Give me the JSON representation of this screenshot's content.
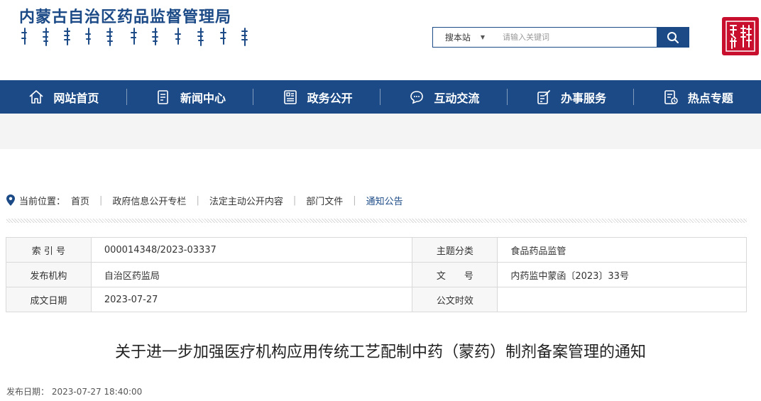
{
  "header": {
    "site_title": "内蒙古自治区药品监督管理局",
    "search": {
      "scope": "搜本站",
      "placeholder": "请输入关键词"
    }
  },
  "nav": {
    "items": [
      {
        "label": "网站首页",
        "icon": "home-icon"
      },
      {
        "label": "新闻中心",
        "icon": "news-icon"
      },
      {
        "label": "政务公开",
        "icon": "document-icon"
      },
      {
        "label": "互动交流",
        "icon": "chat-icon"
      },
      {
        "label": "办事服务",
        "icon": "service-icon"
      },
      {
        "label": "热点专题",
        "icon": "topic-icon"
      }
    ]
  },
  "breadcrumb": {
    "prefix": "当前位置：",
    "items": [
      "首页",
      "政府信息公开专栏",
      "法定主动公开内容",
      "部门文件",
      "通知公告"
    ]
  },
  "info": {
    "index_label": "索 引 号",
    "index_value": "000014348/2023-03337",
    "topic_label": "主题分类",
    "topic_value": "食品药品监管",
    "issuer_label": "发布机构",
    "issuer_value": "自治区药监局",
    "docno_label": "文　　号",
    "docno_value": "内药监中蒙函〔2023〕33号",
    "date_label": "成文日期",
    "date_value": "2023-07-27",
    "validity_label": "公文时效",
    "validity_value": ""
  },
  "article": {
    "title": "关于进一步加强医疗机构应用传统工艺配制中药（蒙药）制剂备案管理的通知",
    "pub_date_label": "发布日期：",
    "pub_date_value": "2023-07-27 18:40:00"
  },
  "colors": {
    "brand_blue": "#1b4a86",
    "seal_red": "#c8102e"
  }
}
